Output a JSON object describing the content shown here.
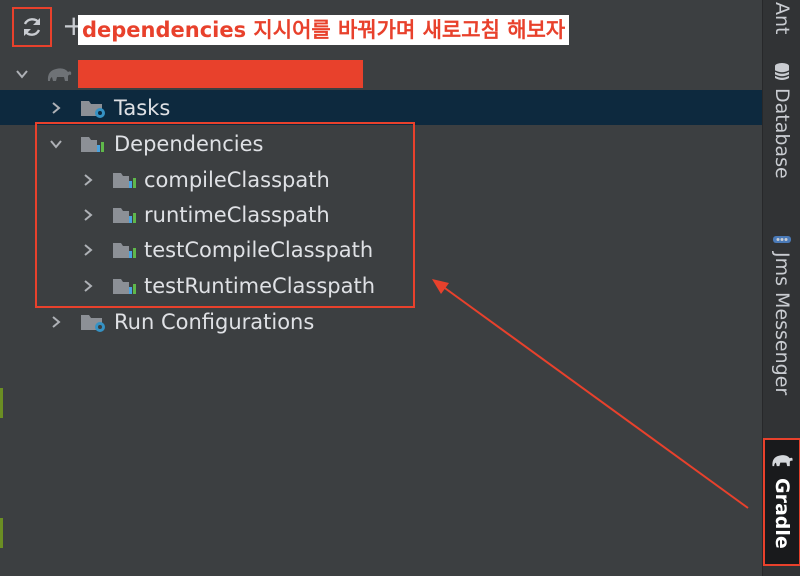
{
  "toolbar": {
    "annotation": "dependencies 지시어를 바꿔가며 새로고침 해보자",
    "plus": "+"
  },
  "tree": {
    "tasks": "Tasks",
    "dependencies": "Dependencies",
    "compile": "compileClasspath",
    "runtime": "runtimeClasspath",
    "test_compile": "testCompileClasspath",
    "test_runtime": "testRuntimeClasspath",
    "run_configs": "Run Configurations"
  },
  "sidebar": {
    "ant": "Ant",
    "database": "Database",
    "jms": "Jms Messenger",
    "gradle": "Gradle"
  },
  "colors": {
    "highlight": "#e8412c",
    "selected_row": "#0d293e",
    "panel_bg": "#3c3f41"
  }
}
